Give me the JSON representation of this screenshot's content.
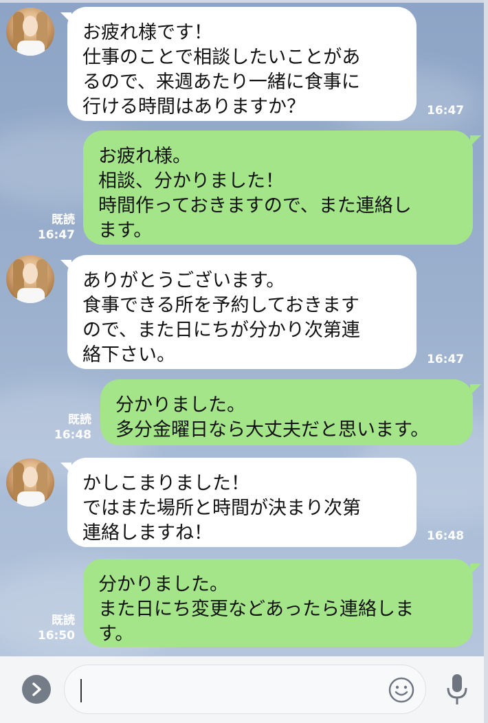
{
  "messages": [
    {
      "side": "in",
      "text": "お疲れ様です！\n仕事のことで相談したいことがあるので、来週あたり一緒に食事に行ける時間はありますか？",
      "time": "16:47"
    },
    {
      "side": "out",
      "text": "お疲れ様。\n相談、分かりました！\n時間作っておきますので、また連絡します。",
      "time": "16:47",
      "read": "既読"
    },
    {
      "side": "in",
      "text": "ありがとうございます。\n食事できる所を予約しておきますので、また日にちが分かり次第連絡下さい。",
      "time": "16:47"
    },
    {
      "side": "out",
      "text": "分かりました。\n多分金曜日なら大丈夫だと思います。",
      "time": "16:48",
      "read": "既読"
    },
    {
      "side": "in",
      "text": "かしこまりました！\nではまた場所と時間が決まり次第連絡しますね！",
      "time": "16:48"
    },
    {
      "side": "out",
      "text": "分かりました。\nまた日にち変更などあったら連絡します。",
      "time": "16:50",
      "read": "既読"
    }
  ],
  "display_lines": [
    "お疲れ様です！\n仕事のことで相談したいことがあ\nるので、来週あたり一緒に食事に\n行ける時間はありますか？",
    "お疲れ様。\n相談、分かりました！\n時間作っておきますので、また連絡し\nます。",
    "ありがとうございます。\n食事できる所を予約しておきます\nので、また日にちが分かり次第連\n絡下さい。",
    "分かりました。\n多分金曜日なら大丈夫だと思います。",
    "かしこまりました！\nではまた場所と時間が決まり次第\n連絡しますね！",
    "分かりました。\nまた日にち変更などあったら連絡しま\nす。"
  ],
  "input_bar": {
    "value": "",
    "expand_icon": "chevron-right-icon",
    "emoji_icon": "smiley-icon",
    "mic_icon": "microphone-icon"
  },
  "colors": {
    "outgoing_bubble": "#a5e58a",
    "incoming_bubble": "#ffffff",
    "chat_background": "#8da4c6"
  }
}
